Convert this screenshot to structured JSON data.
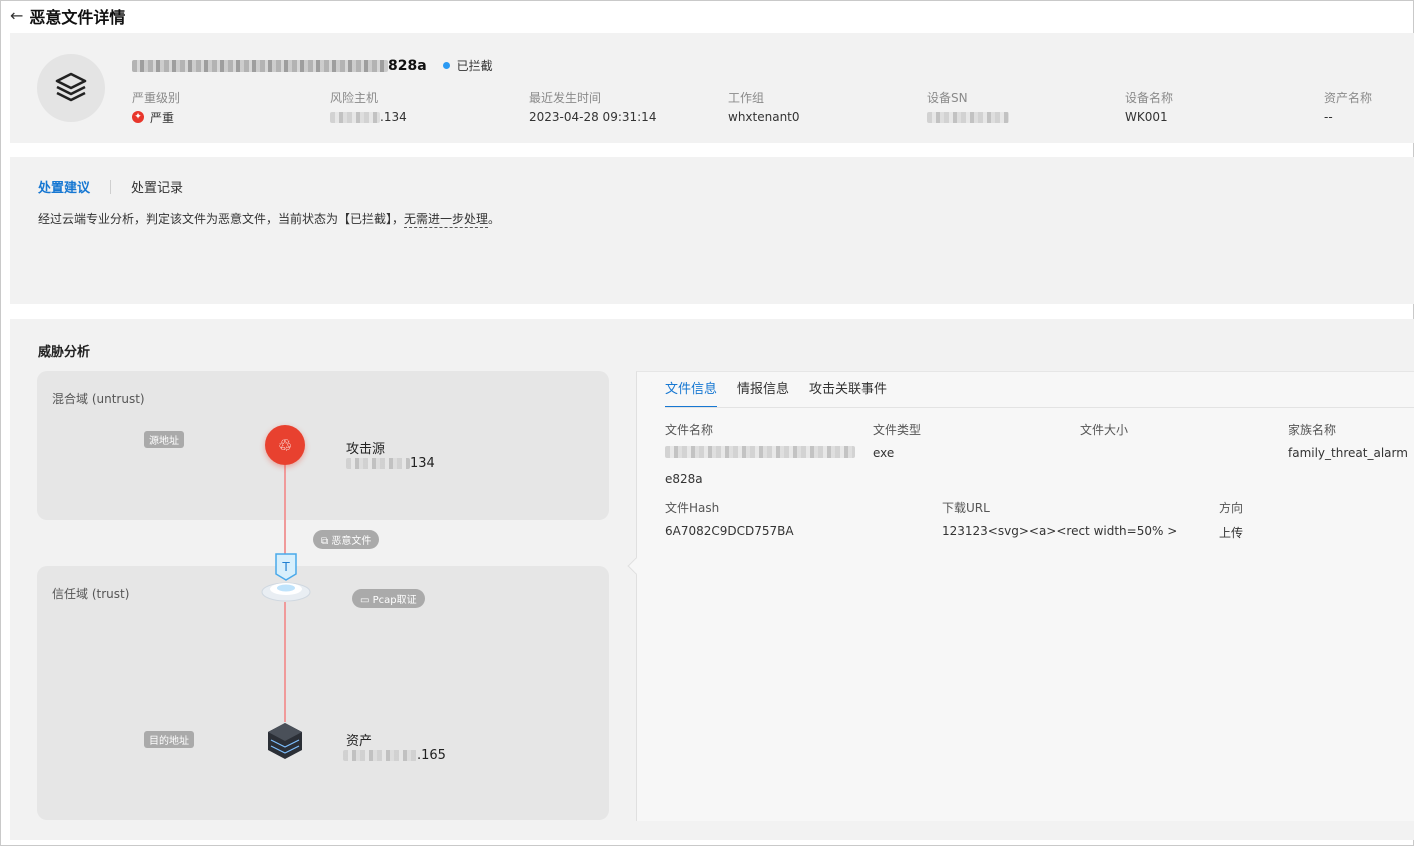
{
  "page": {
    "title": "恶意文件详情"
  },
  "summary": {
    "file_name_suffix": "828a",
    "status": "已拦截",
    "fields": {
      "severity": {
        "label": "严重级别",
        "value": "严重"
      },
      "risk_host": {
        "label": "风险主机",
        "value_suffix": ".134"
      },
      "last_time": {
        "label": "最近发生时间",
        "value": "2023-04-28 09:31:14"
      },
      "workgroup": {
        "label": "工作组",
        "value": "whxtenant0"
      },
      "device_sn": {
        "label": "设备SN"
      },
      "device_name": {
        "label": "设备名称",
        "value": "WK001"
      },
      "asset_name": {
        "label": "资产名称",
        "value": "--"
      }
    }
  },
  "suggestion": {
    "tabs": [
      "处置建议",
      "处置记录"
    ],
    "text_main": "经过云端专业分析，判定该文件为恶意文件，当前状态为【已拦截】，",
    "text_dashed": "无需进一步处理",
    "text_end": "。"
  },
  "threat": {
    "title": "威胁分析",
    "zones": {
      "untrust": "混合域 (untrust)",
      "trust": "信任域 (trust)"
    },
    "pills": {
      "src": "源地址",
      "dst": "目的地址",
      "malicious": "恶意文件",
      "pcap": "Pcap取证"
    },
    "attacker": {
      "label": "攻击源",
      "ip_suffix": "134"
    },
    "asset": {
      "label": "资产",
      "ip_suffix": ".165"
    }
  },
  "detail": {
    "tabs": [
      "文件信息",
      "情报信息",
      "攻击关联事件"
    ],
    "file_name": {
      "label": "文件名称",
      "value_tail": "e828a"
    },
    "file_type": {
      "label": "文件类型",
      "value": "exe"
    },
    "file_size": {
      "label": "文件大小",
      "value": ""
    },
    "family": {
      "label": "家族名称",
      "value": "family_threat_alarm"
    },
    "hash": {
      "label": "文件Hash",
      "value": "6A7082C9DCD757BA"
    },
    "url": {
      "label": "下载URL",
      "value": "123123<svg><a><rect width=50% >"
    },
    "direction": {
      "label": "方向",
      "value": "上传"
    }
  }
}
